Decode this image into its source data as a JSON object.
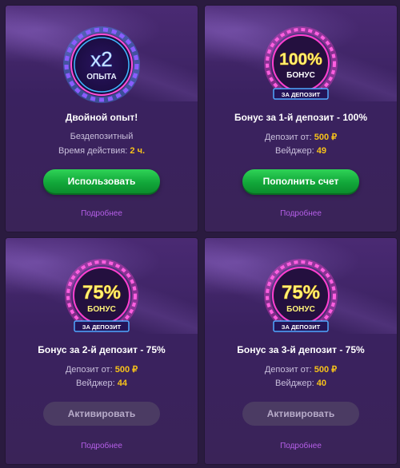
{
  "cards": [
    {
      "badge": {
        "main": "x2",
        "sub": "ОПЫТА",
        "ribbon": ""
      },
      "title": "Двойной опыт!",
      "line1": {
        "label": "Бездепозитный",
        "value": ""
      },
      "line2": {
        "label": "Время действия:",
        "value": "2 ч."
      },
      "button": "Использовать",
      "button_state": "active",
      "more": "Подробнее"
    },
    {
      "badge": {
        "main": "100%",
        "sub": "БОНУС",
        "ribbon": "ЗА ДЕПОЗИТ"
      },
      "title": "Бонус за 1-й депозит - 100%",
      "line1": {
        "label": "Депозит от:",
        "value": "500 ₽"
      },
      "line2": {
        "label": "Вейджер:",
        "value": "49"
      },
      "button": "Пополнить счет",
      "button_state": "active",
      "more": "Подробнее"
    },
    {
      "badge": {
        "main": "75%",
        "sub": "БОНУС",
        "ribbon": "ЗА ДЕПОЗИТ"
      },
      "title": "Бонус за 2-й депозит - 75%",
      "line1": {
        "label": "Депозит от:",
        "value": "500 ₽"
      },
      "line2": {
        "label": "Вейджер:",
        "value": "44"
      },
      "button": "Активировать",
      "button_state": "disabled",
      "more": "Подробнее"
    },
    {
      "badge": {
        "main": "75%",
        "sub": "БОНУС",
        "ribbon": "ЗА ДЕПОЗИТ"
      },
      "title": "Бонус за 3-й депозит - 75%",
      "line1": {
        "label": "Депозит от:",
        "value": "500 ₽"
      },
      "line2": {
        "label": "Вейджер:",
        "value": "40"
      },
      "button": "Активировать",
      "button_state": "disabled",
      "more": "Подробнее"
    }
  ],
  "colors": {
    "background": "#2a1b3f",
    "card": "#3a2260",
    "accent_value": "#f7c21a",
    "link": "#b55fe8",
    "button_green": "#12a83a",
    "button_disabled": "#4b3b63",
    "neon_blue": "#3fa0ff",
    "neon_pink": "#ff3fd0",
    "neon_yellow": "#ffe95a"
  }
}
